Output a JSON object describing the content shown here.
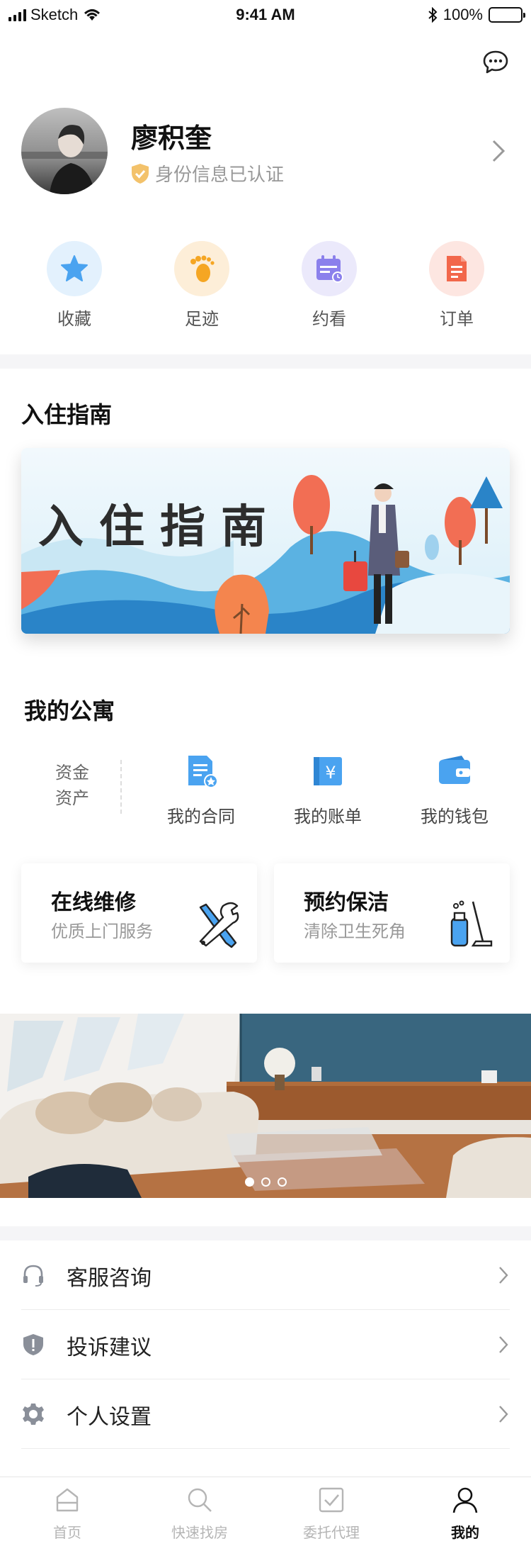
{
  "status_bar": {
    "carrier": "Sketch",
    "time": "9:41 AM",
    "battery": "100%"
  },
  "profile": {
    "name": "廖积奎",
    "verify_text": "身份信息已认证"
  },
  "quick_actions": [
    {
      "label": "收藏",
      "icon": "star-icon",
      "bg": "#e3f1fd",
      "color": "#4aa3f0"
    },
    {
      "label": "足迹",
      "icon": "footprint-icon",
      "bg": "#fdeed8",
      "color": "#f5a623"
    },
    {
      "label": "约看",
      "icon": "calendar-icon",
      "bg": "#ebe9fb",
      "color": "#8b80ec"
    },
    {
      "label": "订单",
      "icon": "order-icon",
      "bg": "#fde6e1",
      "color": "#f2674b"
    }
  ],
  "guide": {
    "section_title": "入住指南",
    "banner_text": "入住指南"
  },
  "apartment": {
    "section_title": "我的公寓",
    "fund_label_1": "资金",
    "fund_label_2": "资产",
    "items": [
      {
        "label": "我的合同",
        "icon": "contract-icon"
      },
      {
        "label": "我的账单",
        "icon": "bill-icon"
      },
      {
        "label": "我的钱包",
        "icon": "wallet-icon"
      }
    ],
    "accent": "#4aa3f0"
  },
  "services": [
    {
      "title": "在线维修",
      "subtitle": "优质上门服务",
      "icon": "tools-icon"
    },
    {
      "title": "预约保洁",
      "subtitle": "清除卫生死角",
      "icon": "cleaning-icon"
    }
  ],
  "carousel": {
    "dots": 3,
    "active": 0
  },
  "menu": [
    {
      "label": "客服咨询",
      "icon": "headset-icon"
    },
    {
      "label": "投诉建议",
      "icon": "shield-alert-icon"
    },
    {
      "label": "个人设置",
      "icon": "gear-icon"
    }
  ],
  "tabbar": [
    {
      "label": "首页",
      "icon": "home-icon",
      "active": false
    },
    {
      "label": "快速找房",
      "icon": "search-icon",
      "active": false
    },
    {
      "label": "委托代理",
      "icon": "checkbox-icon",
      "active": false
    },
    {
      "label": "我的",
      "icon": "user-icon",
      "active": true
    }
  ]
}
